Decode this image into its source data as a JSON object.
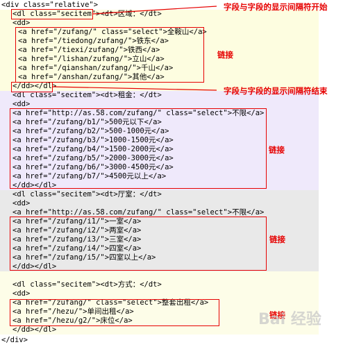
{
  "code": {
    "lines": [
      "<div class=\"relative\">",
      "<dl class=\"secitem\"><dt>区域：</dt>",
      "<dd>",
      "<a href=\"/zufang/\" class=\"select\">全鞍山</a>",
      "<a href=\"/tiedong/zufang/\">铁东</a>",
      "<a href=\"/tiexi/zufang/\">铁西</a>",
      "<a href=\"/lishan/zufang/\">立山</a>",
      "<a href=\"/qianshan/zufang/\">千山</a>",
      "<a href=\"/anshan/zufang/\">其他</a>",
      "</dd></dl>",
      "<dl class=\"secitem\"><dt>租金：</dt>",
      "<dd>",
      "<a href=\"http://as.58.com/zufang/\" class=\"select\">不限</a>",
      "<a href=\"/zufang/b1/\">500元以下</a>",
      "<a href=\"/zufang/b2/\">500-1000元</a>",
      "<a href=\"/zufang/b3/\">1000-1500元</a>",
      "<a href=\"/zufang/b4/\">1500-2000元</a>",
      "<a href=\"/zufang/b5/\">2000-3000元</a>",
      "<a href=\"/zufang/b6/\">3000-4500元</a>",
      "<a href=\"/zufang/b7/\">4500元以上</a>",
      "</dd></dl>",
      "<dl class=\"secitem\"><dt>厅室：</dt>",
      "<dd>",
      "<a href=\"http://as.58.com/zufang/\" class=\"select\">不限</a>",
      "<a href=\"/zufang/i1/\">一室</a>",
      "<a href=\"/zufang/i2/\">两室</a>",
      "<a href=\"/zufang/i3/\">三室</a>",
      "<a href=\"/zufang/i4/\">四室</a>",
      "<a href=\"/zufang/i5/\">四室以上</a>",
      "</dd></dl>",
      "<dl class=\"secitem\"><dt>方式：</dt>",
      "<dd>",
      "<a href=\"/zufang/\" class=\"select\">整套出租</a>",
      "<a href=\"/hezu/\">单间出租</a>",
      "<a href=\"/hezu/g2/\">床位</a>",
      "</dd></dl>",
      "</div>"
    ]
  },
  "annotations": {
    "field_separator_start": "字段与字段的显示间隔符开始",
    "link_1": "链接",
    "field_separator_end": "字段与字段的显示间隔符结束",
    "link_2": "链接",
    "link_3": "链接",
    "link_4": "链接"
  },
  "watermark": "Bai 经验",
  "colors": {
    "annotation": "#e60000",
    "band_yellow": "#fdfde0",
    "band_purple": "#efe9fb",
    "band_gray": "#e9e9e9"
  }
}
